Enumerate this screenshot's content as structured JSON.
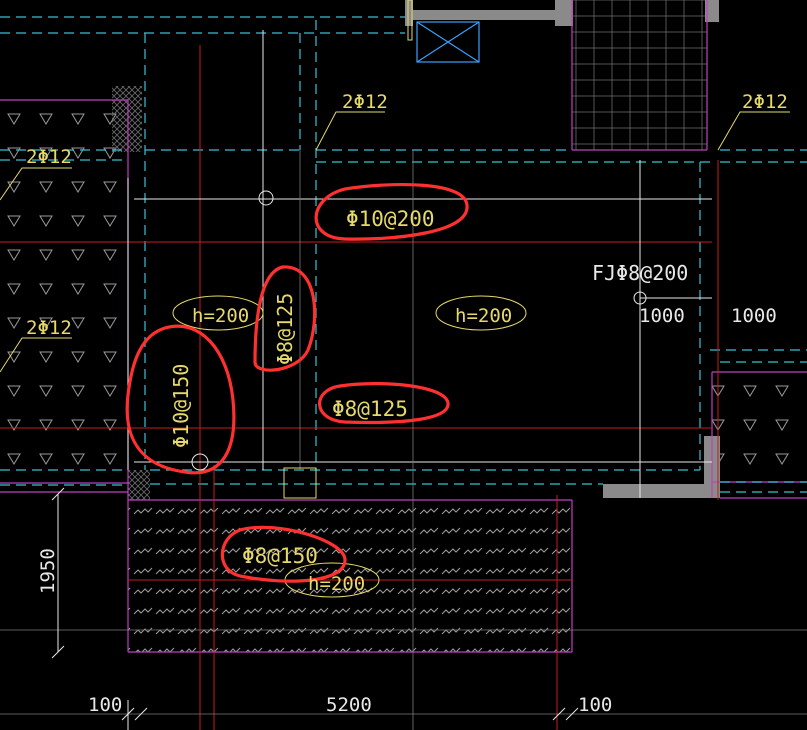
{
  "labels": {
    "bar_2phi12_top_mid": "2Φ12",
    "bar_2phi12_top_right": "2Φ12",
    "bar_2phi12_left_upper": "2Φ12",
    "bar_2phi12_left_lower": "2Φ12",
    "rebar_phi10_200": "Φ10@200",
    "rebar_phi8_125_vertical": "Φ8@125",
    "rebar_phi10_150_vertical": "Φ10@150",
    "rebar_phi8_125": "Φ8@125",
    "rebar_phi8_150": "Φ8@150",
    "fj_rebar": "FJΦ8@200",
    "h_left": "h=200",
    "h_center": "h=200",
    "h_bottom": "h=200",
    "dim_1000_a": "1000",
    "dim_1000_b": "1000",
    "dim_1950": "1950",
    "dim_100_left": "100",
    "dim_5200": "5200",
    "dim_100_right": "100"
  },
  "colors": {
    "background": "#000000",
    "wall_magenta": "#c040c0",
    "axis_red": "#c81e1e",
    "dashed_cyan": "#34c3d6",
    "white_line": "#e8e8e8",
    "label_yellow": "#e6d96a",
    "annotation_red": "#ff3030",
    "hatch_gray": "#8a8a8a",
    "fixture_blue": "#3aa0ff"
  }
}
